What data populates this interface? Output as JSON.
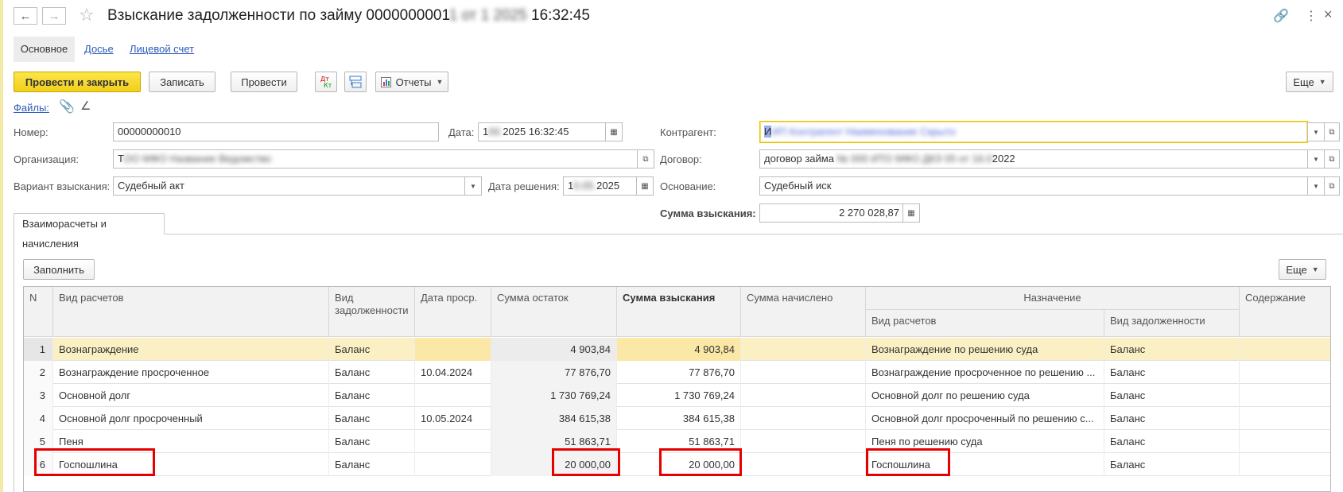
{
  "title": {
    "prefix": "Взыскание задолженности по займу 0000000001",
    "blurred": "1 от 1 2025",
    "suffix": "16:32:45"
  },
  "tabs": [
    {
      "label": "Основное"
    },
    {
      "label": "Досье"
    },
    {
      "label": "Лицевой счет"
    }
  ],
  "toolbar": {
    "post_close": "Провести и закрыть",
    "save": "Записать",
    "post": "Провести",
    "reports": "Отчеты",
    "more": "Еще"
  },
  "files": {
    "label": "Файлы:"
  },
  "form": {
    "number_label": "Номер:",
    "number_value": "00000000010",
    "date_label": "Дата:",
    "date_prefix": "1",
    "date_suffix": "2025 16:32:45",
    "org_label": "Организация:",
    "org_value_prefix": "Т",
    "org_value_blur": "ОО МФО Название Ведомство",
    "variant_label": "Вариант взыскания:",
    "variant_value": "Судебный акт",
    "decision_date_label": "Дата решения:",
    "decision_date_prefix": "1",
    "decision_date_suffix": "2025",
    "counterparty_label": "Контрагент:",
    "counterparty_prefix": "И",
    "counterparty_blur": "ИП Контрагент Наименование Скрыто",
    "contract_label": "Договор:",
    "contract_value_prefix": "договор займа ",
    "contract_value_blur": "№ 000 ИТО МФО ДКЗ 05 от 16.0",
    "contract_value_suffix": "2022",
    "basis_label": "Основание:",
    "basis_value": "Судебный иск",
    "amount_label": "Сумма взыскания:",
    "amount_value": "2 270 028,87"
  },
  "panel": {
    "tab_label": "Взаиморасчеты и начисления",
    "fill_button": "Заполнить",
    "more": "Еще"
  },
  "table": {
    "headers": {
      "n": "N",
      "kind": "Вид расчетов",
      "debt_kind": "Вид задолженности",
      "overdue_date": "Дата проср.",
      "balance": "Сумма остаток",
      "recovery": "Сумма взыскания",
      "accrued": "Сумма начислено",
      "purpose": "Назначение",
      "purpose_kind": "Вид расчетов",
      "purpose_debt": "Вид задолженности",
      "content": "Содержание"
    },
    "rows": [
      {
        "n": "1",
        "kind": "Вознаграждение",
        "debt": "Баланс",
        "date": "",
        "balance": "4 903,84",
        "recovery": "4 903,84",
        "accrued": "",
        "p_kind": "Вознаграждение по решению суда",
        "p_debt": "Баланс",
        "content": ""
      },
      {
        "n": "2",
        "kind": "Вознаграждение просроченное",
        "debt": "Баланс",
        "date": "10.04.2024",
        "balance": "77 876,70",
        "recovery": "77 876,70",
        "accrued": "",
        "p_kind": "Вознаграждение просроченное по решению ...",
        "p_debt": "Баланс",
        "content": ""
      },
      {
        "n": "3",
        "kind": "Основной долг",
        "debt": "Баланс",
        "date": "",
        "balance": "1 730 769,24",
        "recovery": "1 730 769,24",
        "accrued": "",
        "p_kind": "Основной долг по решению суда",
        "p_debt": "Баланс",
        "content": ""
      },
      {
        "n": "4",
        "kind": "Основной долг просроченный",
        "debt": "Баланс",
        "date": "10.05.2024",
        "balance": "384 615,38",
        "recovery": "384 615,38",
        "accrued": "",
        "p_kind": "Основной долг просроченный по решению с...",
        "p_debt": "Баланс",
        "content": ""
      },
      {
        "n": "5",
        "kind": "Пеня",
        "debt": "Баланс",
        "date": "",
        "balance": "51 863,71",
        "recovery": "51 863,71",
        "accrued": "",
        "p_kind": "Пеня по решению суда",
        "p_debt": "Баланс",
        "content": ""
      },
      {
        "n": "6",
        "kind": "Госпошлина",
        "debt": "Баланс",
        "date": "",
        "balance": "20 000,00",
        "recovery": "20 000,00",
        "accrued": "",
        "p_kind": "Госпошлина",
        "p_debt": "Баланс",
        "content": ""
      }
    ]
  },
  "colors": {
    "primary_button": "#f2cf1c",
    "selected_row": "#fbf0c4",
    "highlight": "#e60000",
    "link": "#2a5bb8"
  }
}
